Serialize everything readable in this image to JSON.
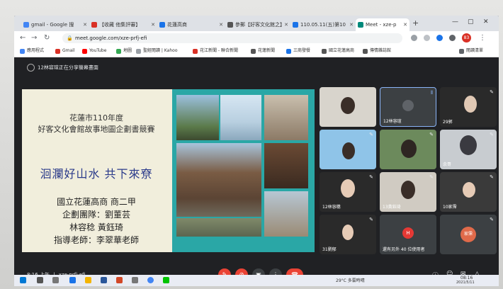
{
  "browser": {
    "tabs": [
      {
        "label": "gmail - Google 搜",
        "color": "#4285f4"
      },
      {
        "label": "【收藏 他集評審】",
        "color": "#d93025"
      },
      {
        "label": "花蓮高商",
        "color": "#1a73e8"
      },
      {
        "label": "參郵【好客文化館之】",
        "color": "#555555"
      },
      {
        "label": "110.05.11(五)第10",
        "color": "#1a73e8"
      },
      {
        "label": "Meet - xze-p",
        "color": "#00897b"
      }
    ],
    "new_tab": "+",
    "url": "meet.google.com/xze-prfj-efi",
    "avatar": "83",
    "bookmarks": [
      {
        "label": "應用程式",
        "color": "#4285f4"
      },
      {
        "label": "Gmail",
        "color": "#d93025"
      },
      {
        "label": "YouTube",
        "color": "#ff0000"
      },
      {
        "label": "地圖",
        "color": "#34a853"
      },
      {
        "label": "聖經閱讀 | Kahoo",
        "color": "#9aa0a6"
      },
      {
        "label": "花江新聞 - 聯合新聞",
        "color": "#d93025"
      },
      {
        "label": "花蓮新聞",
        "color": "#555555"
      },
      {
        "label": "三商發餐",
        "color": "#1a73e8"
      },
      {
        "label": "國立花蓮高商",
        "color": "#555555"
      },
      {
        "label": "傳情雜誌館",
        "color": "#555555"
      }
    ],
    "reading_list": "閱讀清單"
  },
  "meet": {
    "presenting_banner": "12林容瑄正在分享螢幕畫面",
    "slide": {
      "line1": "花蓮市110年度",
      "line2": "好客文化會館故事地圖企劃書競賽",
      "main_title": "洄瀾好山水 共下來尞",
      "school": "國立花蓮高商 商二甲",
      "team": "企劃團隊：劉董芸",
      "members": "林容稔 黃鈺琦",
      "advisor": "指導老師：李翠華老師"
    },
    "participants": [
      {
        "name": "",
        "kind": "video"
      },
      {
        "name": "12林容瑄",
        "kind": "avatar"
      },
      {
        "name": "29郭",
        "kind": "video"
      },
      {
        "name": "",
        "kind": "video"
      },
      {
        "name": "",
        "kind": "video"
      },
      {
        "name": "余哥",
        "kind": "video"
      },
      {
        "name": "12林容穗",
        "kind": "video"
      },
      {
        "name": "13黃鈺琦",
        "kind": "video"
      },
      {
        "name": "10家霈",
        "kind": "video"
      },
      {
        "name": "31劉郁",
        "kind": "video"
      },
      {
        "name": "還有另外 40 位使用者",
        "kind": "more",
        "avatar": "H"
      },
      {
        "name": "",
        "kind": "avatar",
        "avatar": "家霈"
      }
    ],
    "meeting_time": "8:16 上午",
    "meeting_code": "xze-prfj-efi"
  },
  "taskbar": {
    "weather": "29°C 多雲時晴",
    "clock_time": "08:16",
    "clock_date": "2021/5/11"
  }
}
